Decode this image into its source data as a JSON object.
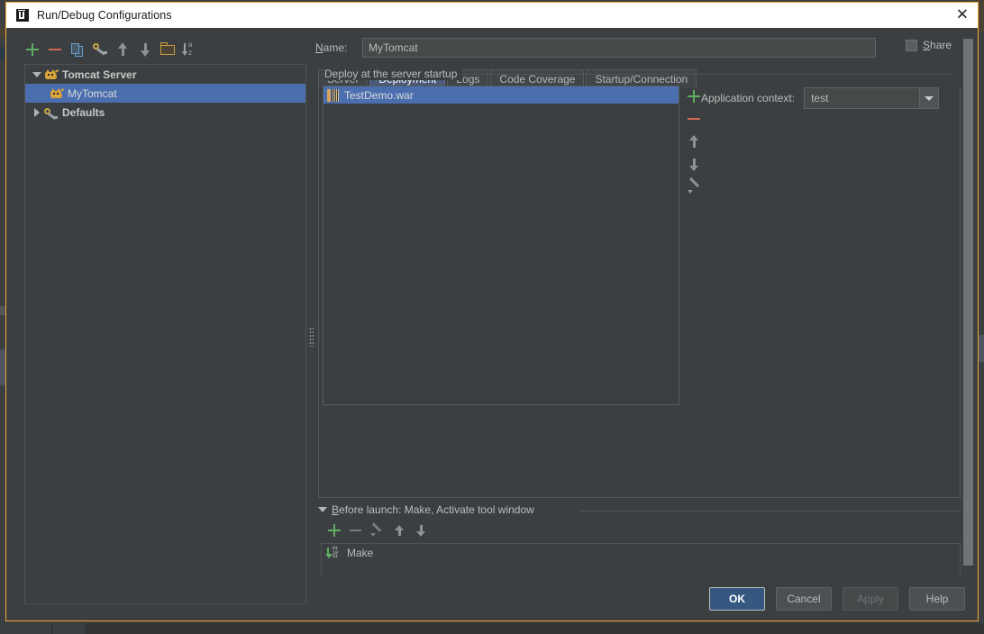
{
  "window": {
    "title": "Run/Debug Configurations",
    "app_icon": "intellij-idea-icon",
    "close_label": "✕"
  },
  "left_panel": {
    "toolbar": [
      {
        "name": "add-configuration-button",
        "icon": "plus-icon",
        "tooltip": "Add New Configuration"
      },
      {
        "name": "remove-configuration-button",
        "icon": "minus-icon",
        "tooltip": "Remove Configuration"
      },
      {
        "name": "copy-configuration-button",
        "icon": "copy-icon",
        "tooltip": "Copy Configuration"
      },
      {
        "name": "edit-defaults-button",
        "icon": "wrench-icon",
        "tooltip": "Edit defaults"
      },
      {
        "name": "move-up-button",
        "icon": "arrow-up-icon",
        "tooltip": "Move Up"
      },
      {
        "name": "move-down-button",
        "icon": "arrow-down-icon",
        "tooltip": "Move Down"
      },
      {
        "name": "create-folder-button",
        "icon": "folder-icon",
        "tooltip": "Create New Folder"
      },
      {
        "name": "sort-configurations-button",
        "icon": "sort-alphabetically-icon",
        "tooltip": "Sort Configurations"
      }
    ],
    "tree": [
      {
        "label": "Tomcat Server",
        "icon": "tomcat-cat-icon",
        "expanded": true,
        "indent": 0,
        "bold": true,
        "selected": false,
        "has_arrow": true
      },
      {
        "label": "MyTomcat",
        "icon": "tomcat-cat-icon",
        "expanded": false,
        "indent": 1,
        "bold": false,
        "selected": true,
        "has_arrow": false
      },
      {
        "label": "Defaults",
        "icon": "wrench-icon",
        "expanded": false,
        "indent": 0,
        "bold": true,
        "selected": false,
        "has_arrow": true
      }
    ]
  },
  "right_panel": {
    "name_label": "Name:",
    "name_label_mnemonic": "N",
    "name_value": "MyTomcat",
    "share_label": "Share",
    "share_label_mnemonic": "S",
    "share_checked": false,
    "tabs": [
      {
        "label": "Server",
        "active": false
      },
      {
        "label": "Deployment",
        "active": true
      },
      {
        "label": "Logs",
        "active": false
      },
      {
        "label": "Code Coverage",
        "active": false
      },
      {
        "label": "Startup/Connection",
        "active": false
      }
    ],
    "deployment": {
      "group_title": "Deploy at the server startup",
      "artifacts": [
        {
          "label": "TestDemo.war",
          "icon": "war-archive-icon",
          "selected": true
        }
      ],
      "list_tools": [
        {
          "name": "add-artifact-button",
          "icon": "plus-icon"
        },
        {
          "name": "remove-artifact-button",
          "icon": "minus-icon"
        },
        {
          "name": "move-artifact-up-button",
          "icon": "arrow-up-icon"
        },
        {
          "name": "move-artifact-down-button",
          "icon": "arrow-down-icon"
        },
        {
          "name": "edit-artifact-button",
          "icon": "pencil-icon"
        }
      ],
      "application_context_label": "Application context:",
      "application_context_value": "test"
    },
    "before_launch": {
      "title": "Before launch: Make, Activate tool window",
      "title_mnemonic": "B",
      "expanded": true,
      "toolbar": [
        {
          "name": "add-task-button",
          "icon": "plus-icon",
          "enabled": true
        },
        {
          "name": "remove-task-button",
          "icon": "minus-icon",
          "enabled": false
        },
        {
          "name": "edit-task-button",
          "icon": "pencil-icon",
          "enabled": false
        },
        {
          "name": "task-move-up-button",
          "icon": "arrow-up-icon",
          "enabled": true
        },
        {
          "name": "task-move-down-button",
          "icon": "arrow-down-icon",
          "enabled": true
        }
      ],
      "tasks": [
        {
          "label": "Make",
          "icon": "build-make-icon"
        }
      ]
    }
  },
  "footer": {
    "buttons": [
      {
        "label": "OK",
        "style": "primary",
        "enabled": true
      },
      {
        "label": "Cancel",
        "style": "normal",
        "enabled": true
      },
      {
        "label": "Apply",
        "style": "disabled",
        "enabled": false
      },
      {
        "label": "Help",
        "style": "normal",
        "enabled": true
      }
    ]
  },
  "colors": {
    "dialog_background": "#3c3f41",
    "dialog_border": "#f0a732",
    "titlebar_background": "#ffffff",
    "selection_blue": "#4b6eaf",
    "active_tab_blue": "#4b5b77",
    "primary_button_blue": "#365880",
    "text": "#bbbbbb",
    "accent_green": "#5fad65",
    "accent_red": "#d0694e",
    "accent_orange": "#d9a43a"
  }
}
